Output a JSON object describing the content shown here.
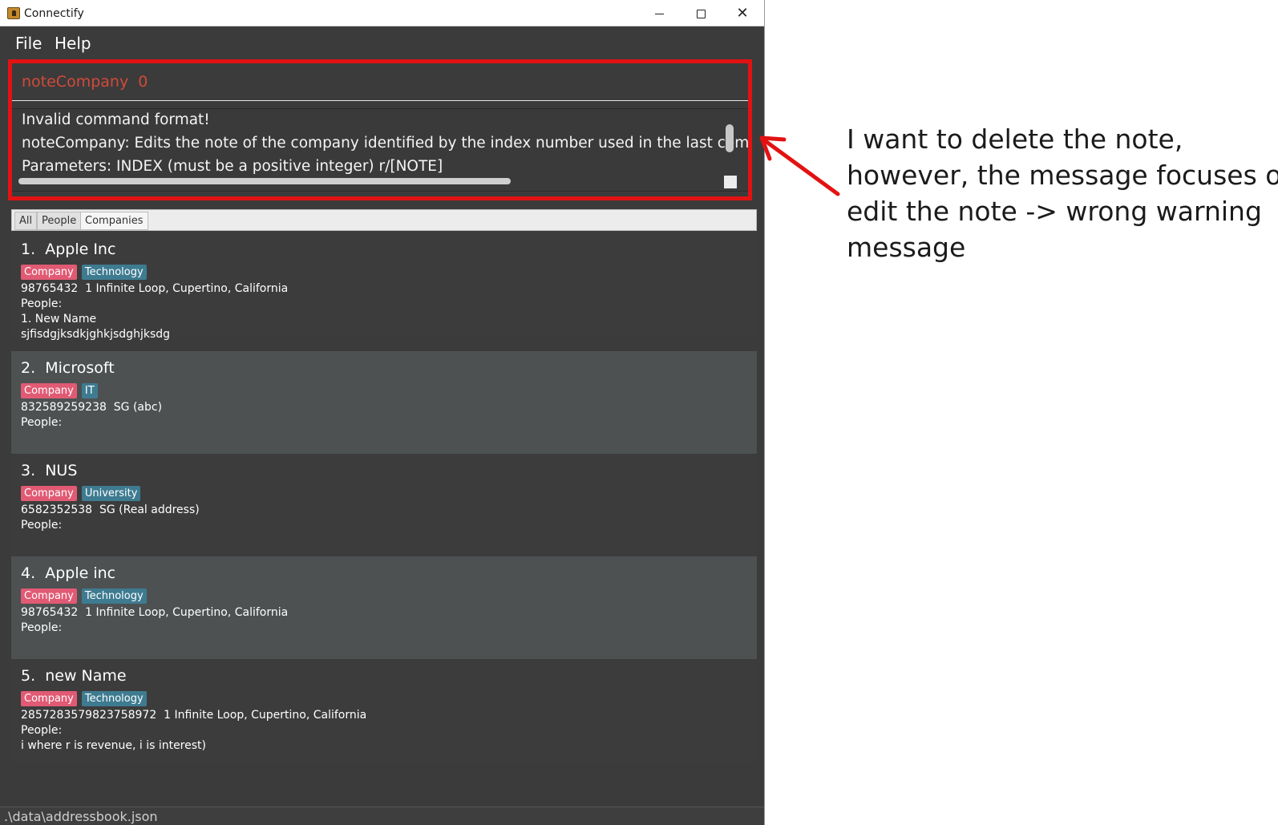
{
  "window": {
    "title": "Connectify",
    "controls": {
      "minimize": "",
      "maximize": "",
      "close": "✕"
    }
  },
  "menu": {
    "file": "File",
    "help": "Help"
  },
  "command": {
    "value": "noteCompany  0"
  },
  "result": {
    "line1": "Invalid command format!",
    "line2": "noteCompany: Edits the note of the company identified by the index number used in the last company listing",
    "line3": "Parameters: INDEX (must be a positive integer) r/[NOTE]"
  },
  "tabs": {
    "all": "All",
    "people": "People",
    "companies": "Companies"
  },
  "companies": [
    {
      "title": "1.  Apple Inc",
      "tags": [
        "Company",
        "Technology"
      ],
      "contact": "98765432  1 Infinite Loop, Cupertino, California",
      "people_label": "People:",
      "extra1": "1. New Name",
      "extra2": "sjfisdgjksdkjghkjsdghjksdg"
    },
    {
      "title": "2.  Microsoft",
      "tags": [
        "Company",
        "IT"
      ],
      "contact": "832589259238  SG (abc)",
      "people_label": "People:"
    },
    {
      "title": "3.  NUS",
      "tags": [
        "Company",
        "University"
      ],
      "contact": "6582352538  SG (Real address)",
      "people_label": "People:"
    },
    {
      "title": "4.  Apple inc",
      "tags": [
        "Company",
        "Technology"
      ],
      "contact": "98765432  1 Infinite Loop, Cupertino, California",
      "people_label": "People:"
    },
    {
      "title": "5.  new Name",
      "tags": [
        "Company",
        "Technology"
      ],
      "contact": "2857283579823758972  1 Infinite Loop, Cupertino, California",
      "people_label": "People:",
      "extra1": "i where r is revenue, i is interest)"
    }
  ],
  "status": {
    "path": ".\\data\\addressbook.json"
  },
  "annotation": {
    "line1": "I want to delete the note,",
    "line2": "however, the message focuses on",
    "line3": "edit the note -> wrong warning",
    "line4": "message"
  },
  "colors": {
    "highlight": "#e31212",
    "command_text": "#d24a3a",
    "tag_company": "#e15a74",
    "tag_category": "#3e7b91",
    "background": "#3b3b3b"
  }
}
